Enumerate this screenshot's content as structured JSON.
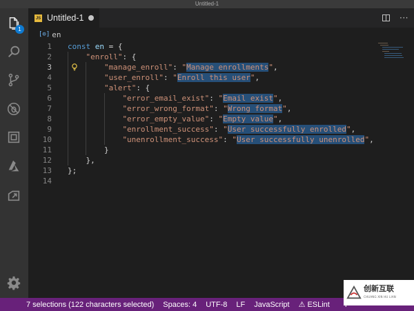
{
  "window": {
    "title": "Untitled-1"
  },
  "activity_bar": {
    "items": [
      {
        "name": "explorer-icon",
        "badge": "1"
      },
      {
        "name": "search-icon"
      },
      {
        "name": "source-control-icon"
      },
      {
        "name": "debug-icon"
      },
      {
        "name": "extensions-icon"
      },
      {
        "name": "azure-icon"
      },
      {
        "name": "live-share-icon"
      }
    ],
    "bottom": {
      "name": "gear-icon"
    }
  },
  "tab": {
    "label": "Untitled-1",
    "language_icon": "JS",
    "dirty": true
  },
  "breadcrumb": {
    "symbol": "en"
  },
  "editor": {
    "current_line": 3,
    "lines": [
      {
        "n": "1",
        "indent": 0,
        "parts": [
          {
            "t": "kw",
            "v": "const"
          },
          {
            "t": "plain",
            "v": " "
          },
          {
            "t": "var",
            "v": "en"
          },
          {
            "t": "plain",
            "v": " = {"
          }
        ]
      },
      {
        "n": "2",
        "indent": 1,
        "parts": [
          {
            "t": "str",
            "v": "\"enroll\""
          },
          {
            "t": "plain",
            "v": ": {"
          }
        ]
      },
      {
        "n": "3",
        "indent": 2,
        "parts": [
          {
            "t": "str",
            "v": "\"manage_enroll\""
          },
          {
            "t": "plain",
            "v": ": "
          },
          {
            "t": "str",
            "v": "\""
          },
          {
            "t": "strsel",
            "v": "Manage enrollments"
          },
          {
            "t": "str",
            "v": "\""
          },
          {
            "t": "plain",
            "v": ","
          }
        ]
      },
      {
        "n": "4",
        "indent": 2,
        "parts": [
          {
            "t": "str",
            "v": "\"user_enroll\""
          },
          {
            "t": "plain",
            "v": ": "
          },
          {
            "t": "str",
            "v": "\""
          },
          {
            "t": "strsel",
            "v": "Enroll this user"
          },
          {
            "t": "str",
            "v": "\""
          },
          {
            "t": "plain",
            "v": ","
          }
        ]
      },
      {
        "n": "5",
        "indent": 2,
        "parts": [
          {
            "t": "str",
            "v": "\"alert\""
          },
          {
            "t": "plain",
            "v": ": {"
          }
        ]
      },
      {
        "n": "6",
        "indent": 3,
        "parts": [
          {
            "t": "str",
            "v": "\"error_email_exist\""
          },
          {
            "t": "plain",
            "v": ": "
          },
          {
            "t": "str",
            "v": "\""
          },
          {
            "t": "strsel",
            "v": "Email exist"
          },
          {
            "t": "str",
            "v": "\""
          },
          {
            "t": "plain",
            "v": ","
          }
        ]
      },
      {
        "n": "7",
        "indent": 3,
        "parts": [
          {
            "t": "str",
            "v": "\"error_wrong_format\""
          },
          {
            "t": "plain",
            "v": ": "
          },
          {
            "t": "str",
            "v": "\""
          },
          {
            "t": "strsel",
            "v": "Wrong format"
          },
          {
            "t": "str",
            "v": "\""
          },
          {
            "t": "plain",
            "v": ","
          }
        ]
      },
      {
        "n": "8",
        "indent": 3,
        "parts": [
          {
            "t": "str",
            "v": "\"error_empty_value\""
          },
          {
            "t": "plain",
            "v": ": "
          },
          {
            "t": "str",
            "v": "\""
          },
          {
            "t": "strsel",
            "v": "Empty value"
          },
          {
            "t": "str",
            "v": "\""
          },
          {
            "t": "plain",
            "v": ","
          }
        ]
      },
      {
        "n": "9",
        "indent": 3,
        "parts": [
          {
            "t": "str",
            "v": "\"enrollment_success\""
          },
          {
            "t": "plain",
            "v": ": "
          },
          {
            "t": "str",
            "v": "\""
          },
          {
            "t": "strsel",
            "v": "User successfully enrolled"
          },
          {
            "t": "str",
            "v": "\""
          },
          {
            "t": "plain",
            "v": ","
          }
        ]
      },
      {
        "n": "10",
        "indent": 3,
        "parts": [
          {
            "t": "str",
            "v": "\"unenrollment_success\""
          },
          {
            "t": "plain",
            "v": ": "
          },
          {
            "t": "str",
            "v": "\""
          },
          {
            "t": "strsel",
            "v": "User successfully unenrolled"
          },
          {
            "t": "str",
            "v": "\""
          },
          {
            "t": "plain",
            "v": ","
          }
        ]
      },
      {
        "n": "11",
        "indent": 2,
        "parts": [
          {
            "t": "plain",
            "v": "}"
          }
        ]
      },
      {
        "n": "12",
        "indent": 1,
        "parts": [
          {
            "t": "plain",
            "v": "},"
          }
        ]
      },
      {
        "n": "13",
        "indent": 0,
        "parts": [
          {
            "t": "plain",
            "v": "};"
          }
        ]
      },
      {
        "n": "14",
        "indent": 0,
        "parts": []
      }
    ]
  },
  "status_bar": {
    "selections": "7 selections (122 characters selected)",
    "spaces": "Spaces: 4",
    "encoding": "UTF-8",
    "eol": "LF",
    "language": "JavaScript",
    "eslint": "ESLint",
    "trailing": "P"
  },
  "watermark": {
    "text": "创新互联",
    "sub": "CHUANG XIN HU LIAN"
  },
  "colors": {
    "status_bar": "#68217a",
    "selection": "#264f78",
    "keyword": "#569cd6",
    "string": "#ce9178",
    "variable": "#9cdcfe"
  }
}
